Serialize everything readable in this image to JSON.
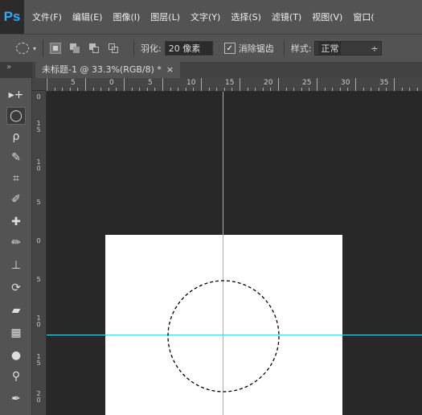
{
  "app": {
    "logo": "Ps"
  },
  "menu": [
    "文件(F)",
    "编辑(E)",
    "图像(I)",
    "图层(L)",
    "文字(Y)",
    "选择(S)",
    "滤镜(T)",
    "视图(V)",
    "窗口("
  ],
  "options": {
    "feather_label": "羽化:",
    "feather_value": "20 像素",
    "antialias_label": "消除锯齿",
    "antialias_checked": "✓",
    "style_label": "样式:",
    "style_value": "正常",
    "style_caret": "÷"
  },
  "document_tab": {
    "title": "未标题-1 @ 33.3%(RGB/8) *",
    "close": "×"
  },
  "ruler": {
    "top_labels": [
      "5",
      "0",
      "5",
      "10",
      "15",
      "20",
      "25",
      "30",
      "35"
    ],
    "left_labels": [
      "0",
      "1 5",
      "1 0",
      "5",
      "0",
      "5",
      "1 0",
      "1 5",
      "2 0"
    ]
  },
  "tools": [
    {
      "icon": "move-icon",
      "glyph": "▸+"
    },
    {
      "icon": "elliptical-marquee-icon",
      "glyph": "◯"
    },
    {
      "icon": "lasso-icon",
      "glyph": "ρ"
    },
    {
      "icon": "quick-selection-icon",
      "glyph": "✎"
    },
    {
      "icon": "crop-icon",
      "glyph": "⌗"
    },
    {
      "icon": "eyedropper-icon",
      "glyph": "✐"
    },
    {
      "icon": "healing-brush-icon",
      "glyph": "✚"
    },
    {
      "icon": "brush-icon",
      "glyph": "✏"
    },
    {
      "icon": "clone-stamp-icon",
      "glyph": "⊥"
    },
    {
      "icon": "history-brush-icon",
      "glyph": "⟳"
    },
    {
      "icon": "eraser-icon",
      "glyph": "▰"
    },
    {
      "icon": "gradient-icon",
      "glyph": "▦"
    },
    {
      "icon": "blur-icon",
      "glyph": "●"
    },
    {
      "icon": "dodge-icon",
      "glyph": "⚲"
    },
    {
      "icon": "pen-icon",
      "glyph": "✒"
    }
  ],
  "colors": {
    "guide": "#48d7e6",
    "ps_brand": "#31a8ff",
    "canvas_bg": "#282828",
    "document_bg": "#ffffff"
  }
}
